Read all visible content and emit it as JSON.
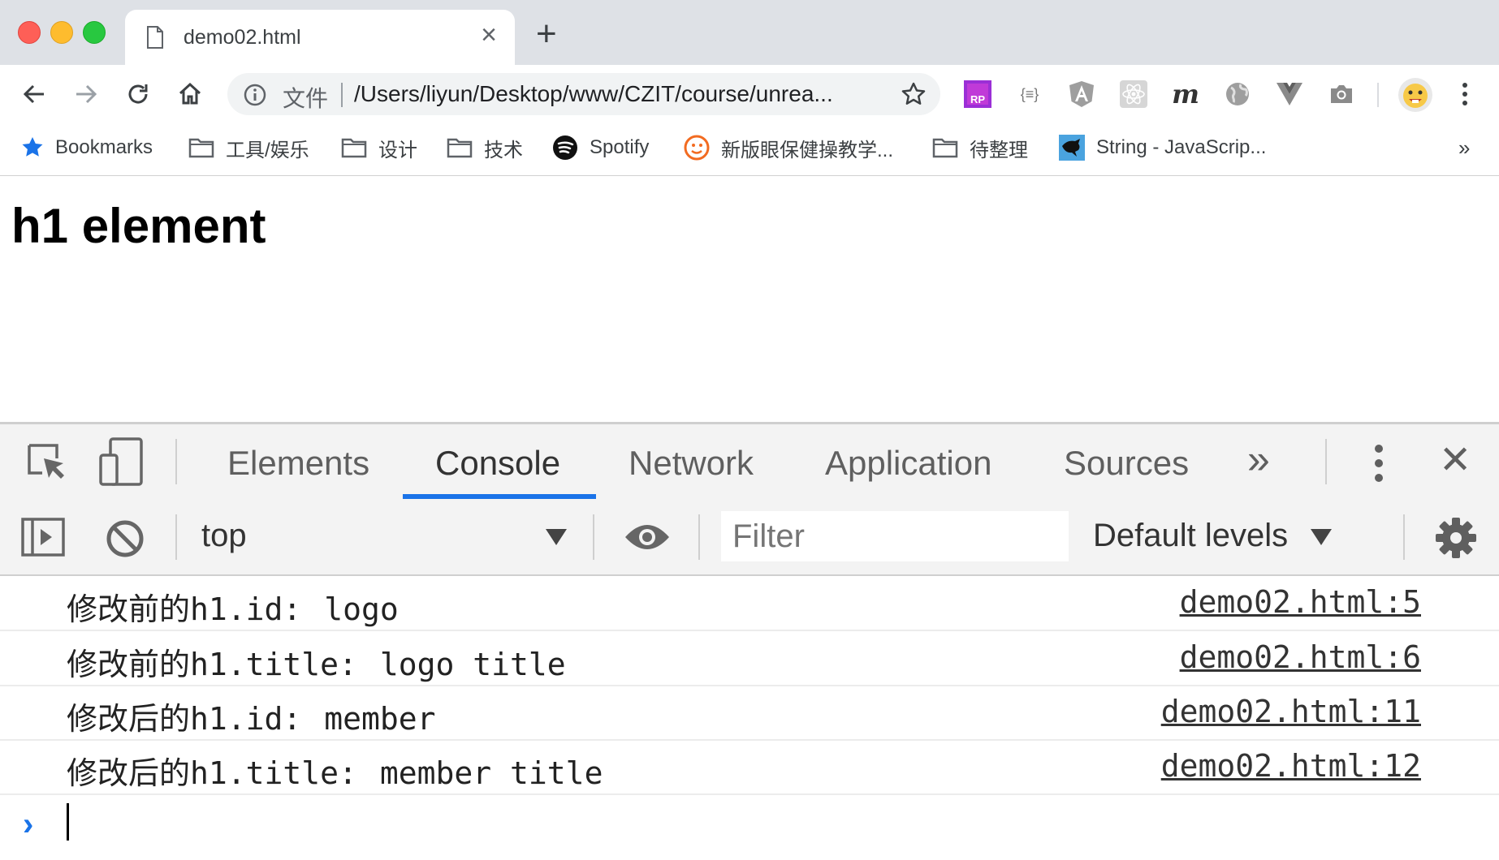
{
  "browser": {
    "tab_title": "demo02.html",
    "tab_close": "×",
    "new_tab": "+",
    "omnibox": {
      "scheme_label": "文件",
      "url": "/Users/liyun/Desktop/www/CZIT/course/unrea..."
    },
    "extensions": [
      "rp-icon",
      "json-icon",
      "angular-icon",
      "react-icon",
      "m-icon",
      "globe-icon",
      "vue-icon",
      "camera-icon",
      "emoji-avatar"
    ],
    "ext_m_label": "m",
    "ext_json_label": "{≡}",
    "bookmarks": [
      {
        "label": "Bookmarks",
        "icon": "star-icon"
      },
      {
        "label": "工具/娱乐",
        "icon": "folder-icon"
      },
      {
        "label": "设计",
        "icon": "folder-icon"
      },
      {
        "label": "技术",
        "icon": "folder-icon"
      },
      {
        "label": "Spotify",
        "icon": "spotify-icon"
      },
      {
        "label": "新版眼保健操教学...",
        "icon": "smile-icon"
      },
      {
        "label": "待整理",
        "icon": "folder-icon"
      },
      {
        "label": "String - JavaScrip...",
        "icon": "bird-icon"
      }
    ],
    "bookmarks_overflow": "»"
  },
  "page": {
    "heading": "h1 element"
  },
  "devtools": {
    "tabs": [
      "Elements",
      "Console",
      "Network",
      "Application",
      "Sources"
    ],
    "more_tabs": "»",
    "active_tab": "Console",
    "close": "✕",
    "context": "top",
    "filter_placeholder": "Filter",
    "levels": "Default levels",
    "logs": [
      {
        "label": "修改前的h1.id:",
        "value": "logo",
        "source": "demo02.html:5"
      },
      {
        "label": "修改前的h1.title:",
        "value": "logo title",
        "source": "demo02.html:6"
      },
      {
        "label": "修改后的h1.id:",
        "value": "member",
        "source": "demo02.html:11"
      },
      {
        "label": "修改后的h1.title:",
        "value": "member title",
        "source": "demo02.html:12"
      }
    ],
    "prompt": "›"
  }
}
